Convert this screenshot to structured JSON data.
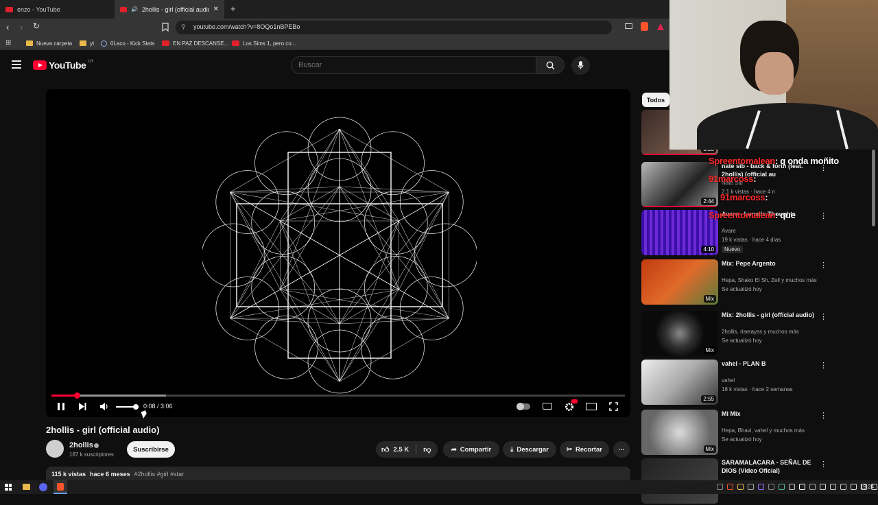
{
  "browser": {
    "tabs": [
      {
        "label": "enzo - YouTube"
      },
      {
        "label": "2hollis - girl (official audio) -"
      }
    ],
    "new_tab": "+",
    "url": "youtube.com/watch?v=8OQo1nBPEBo",
    "bookmarks": [
      {
        "label": "Nueva carpeta"
      },
      {
        "label": "yt"
      },
      {
        "label": "0Laco - Kick Stats"
      },
      {
        "label": "EN PAZ DESCANSE..."
      },
      {
        "label": "Los Sims 1, pero co..."
      }
    ]
  },
  "youtube": {
    "logo": "YouTube",
    "region": "UY",
    "search_placeholder": "Buscar",
    "player": {
      "time": "0:08 / 3:06",
      "progress": 0.044,
      "volume": 0.85
    },
    "video_title": "2hollis - girl (official audio)",
    "channel": {
      "name": "2hollis",
      "subs": "187 k suscriptores",
      "subscribe": "Suscribirse"
    },
    "actions": {
      "likes": "2.5 K",
      "share": "Compartir",
      "download": "Descargar",
      "clip": "Recortar"
    },
    "description": {
      "views": "115 k vistas",
      "age": "hace 6 meses",
      "tags": "#2hollis #girl #star"
    },
    "sidebar": {
      "chip": "Todos",
      "items": [
        {
          "title": "",
          "channel": "",
          "meta": "",
          "duration": "3:28",
          "badge": ""
        },
        {
          "title": "nate sib - back & forth (feat. 2hollis) (official au",
          "channel": "Nate Sib",
          "meta": "2.1 k vistas · hace 4 n",
          "duration": "2:44",
          "badge": ""
        },
        {
          "title": "Avare - Lunatic Thoughts",
          "channel": "Avare",
          "meta": "19 k vistas · hace 4 días",
          "duration": "4:10",
          "badge": "Nuevo"
        },
        {
          "title": "Mix: Pepe Argento",
          "channel": "Hepa, Shako El Sh, Zell y muchos más",
          "meta": "Se actualizó hoy",
          "duration": "Mix",
          "badge": ""
        },
        {
          "title": "Mix: 2hollis - girl (official audio)",
          "channel": "2hollis, riserayss y muchos más",
          "meta": "Se actualizó hoy",
          "duration": "Mix",
          "badge": ""
        },
        {
          "title": "vahel - PLAN B",
          "channel": "vahel",
          "meta": "18 k vistas · hace 2 semanas",
          "duration": "2:55",
          "badge": ""
        },
        {
          "title": "Mi Mix",
          "channel": "Hepa, Bhavi, vahel y muchos más",
          "meta": "Se actualizó hoy",
          "duration": "Mix",
          "badge": ""
        },
        {
          "title": "SARAMALACARA - SEÑAL DE DIOS (Video Oficial)",
          "channel": "",
          "meta": "",
          "duration": "",
          "badge": ""
        }
      ]
    }
  },
  "stream_chat": [
    {
      "user": "Spreentomalean",
      "message": ": q onda moñito"
    },
    {
      "user": "91marcoss",
      "message": ":"
    },
    {
      "user": "91marcoss",
      "message": ":"
    },
    {
      "user": "Spreentomalean",
      "message": ": que"
    }
  ],
  "taskbar": {
    "clock": "19:24"
  },
  "colors": {
    "accent": "#ff0033",
    "chat_user": "#ff2a2a",
    "bg": "#0f0f0f"
  }
}
